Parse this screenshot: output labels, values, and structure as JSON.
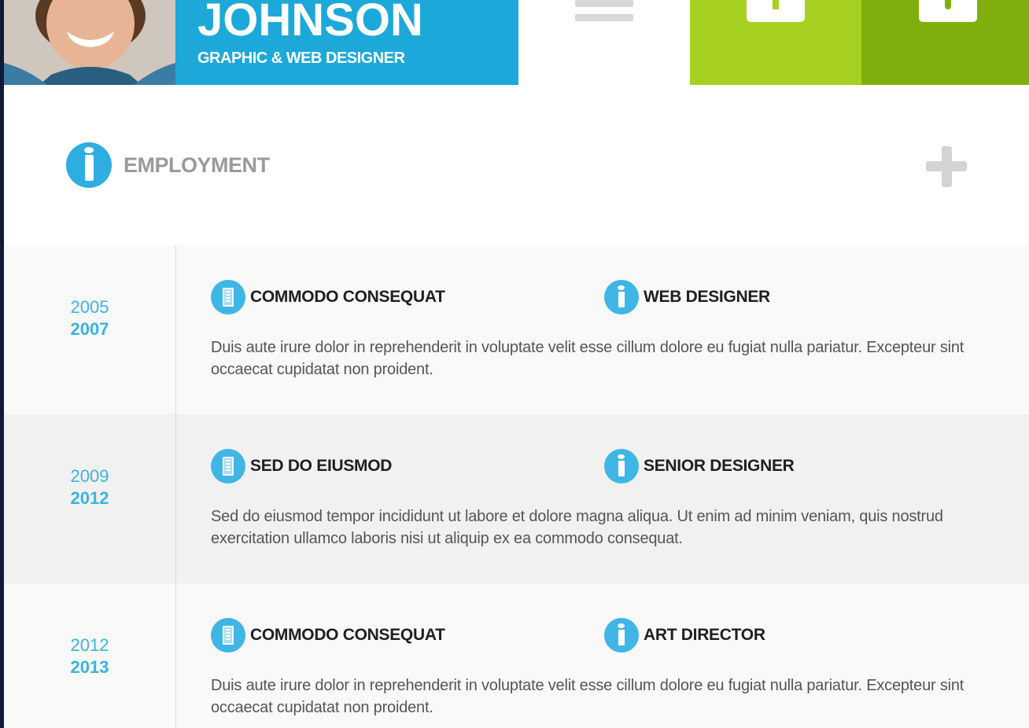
{
  "header": {
    "name": "JOHNSON",
    "job_title": "GRAPHIC & WEB DESIGNER"
  },
  "section": {
    "title": "EMPLOYMENT"
  },
  "colors": {
    "accent_blue": "#1ca9d9",
    "green_light": "#a6d022",
    "green_dark": "#80af0d"
  },
  "employment": [
    {
      "year_start": "2005",
      "year_end": "2007",
      "company": "COMMODO CONSEQUAT",
      "role": "WEB DESIGNER",
      "description": "Duis aute irure dolor in reprehenderit in voluptate velit esse cillum dolore eu fugiat nulla pariatur. Excepteur sint occaecat cupidatat non proident."
    },
    {
      "year_start": "2009",
      "year_end": "2012",
      "company": "SED DO EIUSMOD",
      "role": "SENIOR DESIGNER",
      "description": "Sed do eiusmod tempor incididunt ut labore et dolore magna aliqua. Ut enim ad minim veniam, quis nostrud exercitation ullamco laboris nisi ut aliquip ex ea commodo consequat."
    },
    {
      "year_start": "2012",
      "year_end": "2013",
      "company": "COMMODO CONSEQUAT",
      "role": "ART DIRECTOR",
      "description": "Duis aute irure dolor in reprehenderit in voluptate velit esse cillum dolore eu fugiat nulla pariatur. Excepteur sint occaecat cupidatat non proident."
    }
  ]
}
